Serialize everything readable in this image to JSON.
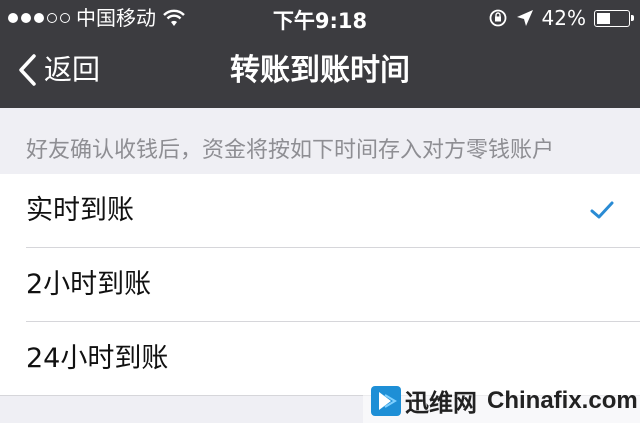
{
  "status_bar": {
    "carrier": "中国移动",
    "time": "下午9:18",
    "battery": "42%",
    "battery_level": 0.42,
    "icons": [
      "signal-dots-icon",
      "wifi-icon",
      "orientation-lock-icon",
      "location-icon",
      "battery-icon"
    ]
  },
  "nav": {
    "back_label": "返回",
    "title": "转账到账时间"
  },
  "section": {
    "header": "好友确认收钱后，资金将按如下时间存入对方零钱账户"
  },
  "options": [
    {
      "label": "实时到账",
      "selected": true
    },
    {
      "label": "2小时到账",
      "selected": false
    },
    {
      "label": "24小时到账",
      "selected": false
    }
  ],
  "colors": {
    "nav_background": "#3c3c40",
    "page_background": "#efeff4",
    "accent": "#2a8bd4"
  },
  "watermark": {
    "cn": "迅维网",
    "en": "Chinafix.com"
  }
}
